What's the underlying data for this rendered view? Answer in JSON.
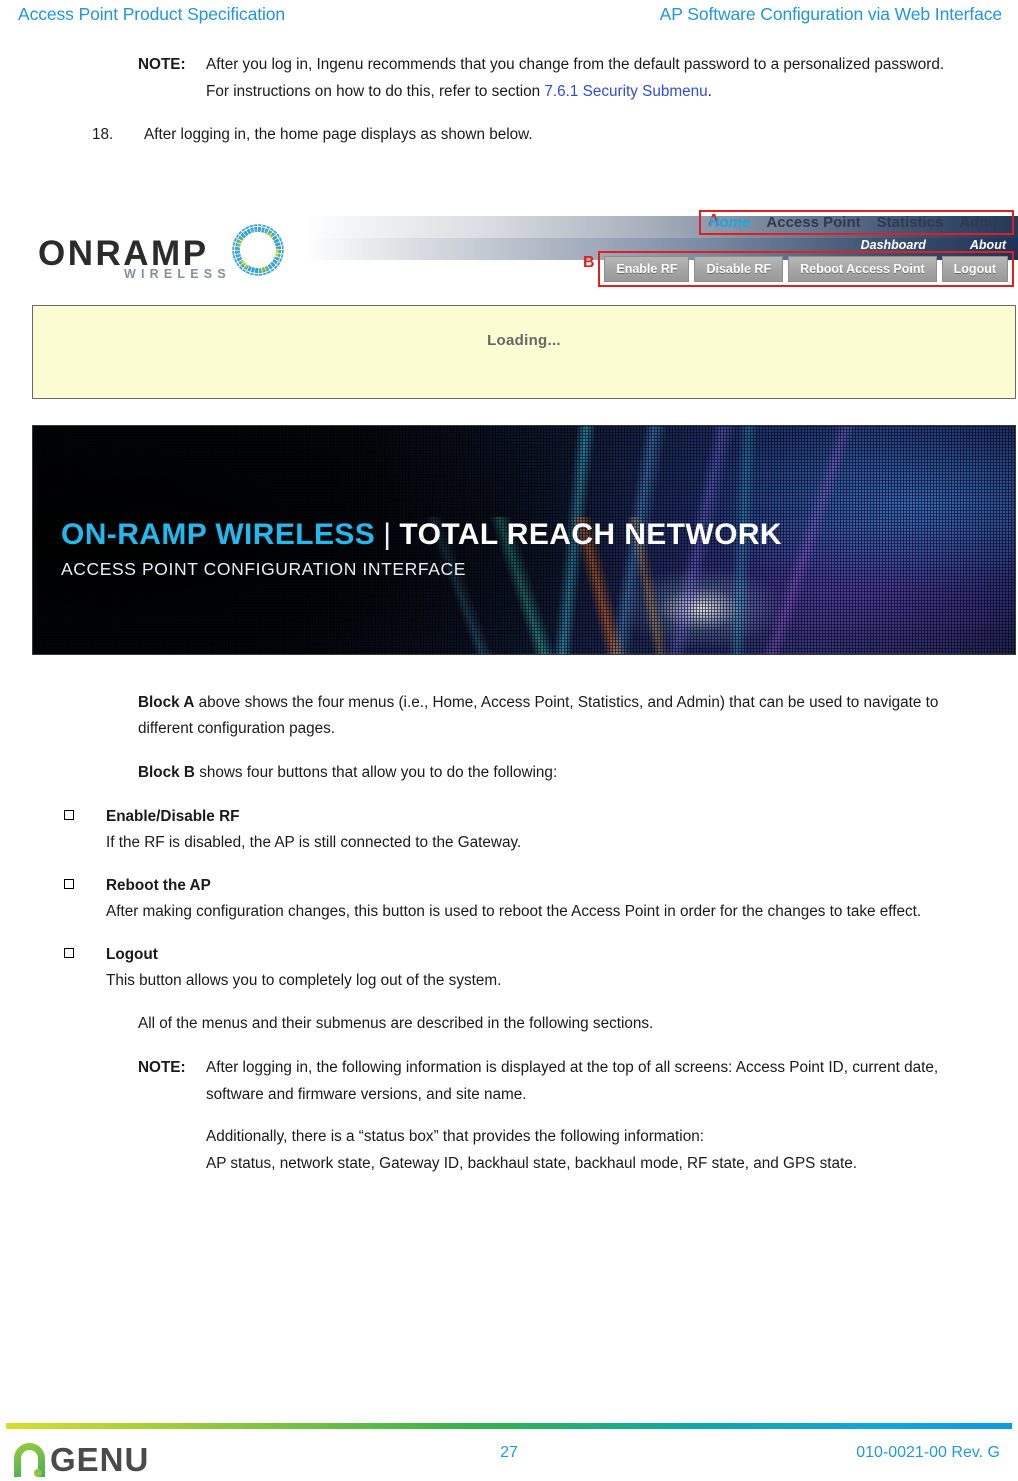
{
  "header": {
    "left": "Access Point Product Specification",
    "right": "AP Software Configuration via Web Interface"
  },
  "note_top": {
    "label": "NOTE:",
    "text_before": "After you log in, Ingenu recommends that you change from the default password to a personalized password. For instructions on how to do this, refer to section ",
    "xref": "7.6.1 Security Submenu",
    "text_after": "."
  },
  "step": {
    "number": "18.",
    "text": "After logging in, the home page displays as shown below."
  },
  "screenshot": {
    "logo": {
      "word": "ONRAMP",
      "sub": "WIRELESS",
      "ring_icon": "dotted-ring-icon"
    },
    "block_a_label": "A",
    "block_b_label": "B",
    "nav": [
      {
        "label": "Home",
        "active": true
      },
      {
        "label": "Access Point",
        "active": false
      },
      {
        "label": "Statistics",
        "active": false
      },
      {
        "label": "Admin",
        "active": false
      }
    ],
    "subnav": [
      {
        "label": "Dashboard"
      },
      {
        "label": "About"
      }
    ],
    "buttons": [
      {
        "label": "Enable RF"
      },
      {
        "label": "Disable RF"
      },
      {
        "label": "Reboot Access Point"
      },
      {
        "label": "Logout"
      }
    ],
    "loading_text": "Loading...",
    "hero": {
      "brand": "ON-RAMP WIRELESS",
      "divider": "|",
      "title": "TOTAL REACH NETWORK",
      "subtitle": "ACCESS POINT CONFIGURATION INTERFACE"
    }
  },
  "prose": {
    "block_a_lead": "Block A",
    "block_a_text": " above shows the four menus (i.e., Home, Access Point, Statistics, and Admin) that can be used to navigate to different configuration pages.",
    "block_b_lead": "Block B",
    "block_b_text": " shows four buttons that allow you to do the following:"
  },
  "bullets": [
    {
      "title": "Enable/Disable RF",
      "body": "If the RF is disabled, the AP is still connected to the Gateway."
    },
    {
      "title": "Reboot the AP",
      "body": "After making configuration changes, this button is used to reboot the Access Point in order for the changes to take effect."
    },
    {
      "title": "Logout",
      "body": "This button allows you to completely log out of the system."
    }
  ],
  "closing_para": "All of the menus and their submenus are described in the following sections.",
  "note_bottom": {
    "label": "NOTE:",
    "para1": "After logging in, the following information is displayed at the top of all screens: Access Point ID, current date, software and firmware versions, and site name.",
    "para2_line1": "Additionally, there is a “status box” that provides the following information:",
    "para2_line2": "AP status, network state, Gateway ID, backhaul state, backhaul mode, RF state, and GPS state."
  },
  "footer": {
    "logo_word": "GENU",
    "page_number": "27",
    "doc_number": "010-0021-00 Rev. G"
  },
  "colors": {
    "header_blue": "#2196dd",
    "xref_blue": "#2f4dd0",
    "annotation_red": "#e02020",
    "nav_active": "#19a8e0",
    "loading_bg": "#fcfcd2",
    "footer_blue": "#1e9bd9"
  }
}
